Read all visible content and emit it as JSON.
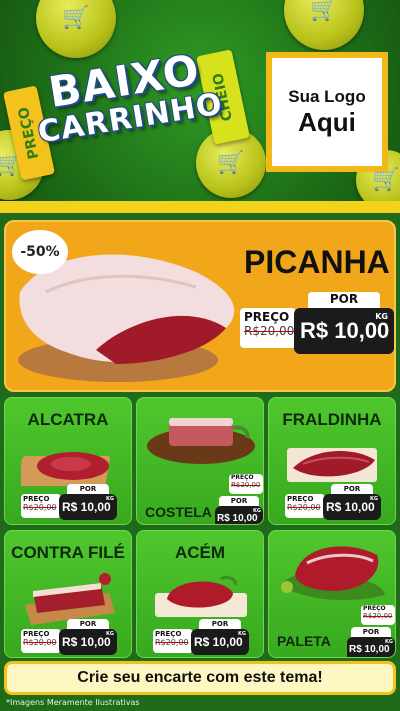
{
  "header": {
    "ribbon_left": "PREÇO",
    "ribbon_right": "CHEIO",
    "title_line1": "BAIXO",
    "title_line2": "CARRINHO",
    "logo_line1": "Sua Logo",
    "logo_line2": "Aqui"
  },
  "hero": {
    "discount": "-50%",
    "name": "PICANHA",
    "price_label": "PREÇO",
    "old_price": "R$20,00",
    "por_label": "POR",
    "new_price": "R$ 10,00",
    "unit": "KG"
  },
  "products": [
    {
      "name": "ALCATRA",
      "price_label": "PREÇO",
      "old_price": "R$20,00",
      "por_label": "POR",
      "new_price": "R$ 10,00",
      "unit": "KG"
    },
    {
      "name": "COSTELA",
      "price_label": "PREÇO",
      "old_price": "R$20,00",
      "por_label": "POR",
      "new_price": "R$ 10,00",
      "unit": "KG"
    },
    {
      "name": "FRALDINHA",
      "price_label": "PREÇO",
      "old_price": "R$20,00",
      "por_label": "POR",
      "new_price": "R$ 10,00",
      "unit": "KG"
    },
    {
      "name": "CONTRA FILÉ",
      "price_label": "PREÇO",
      "old_price": "R$20,00",
      "por_label": "POR",
      "new_price": "R$ 10,00",
      "unit": "KG"
    },
    {
      "name": "ACÉM",
      "price_label": "PREÇO",
      "old_price": "R$20,00",
      "por_label": "POR",
      "new_price": "R$ 10,00",
      "unit": "KG"
    },
    {
      "name": "PALETA",
      "price_label": "PREÇO",
      "old_price": "R$20,00",
      "por_label": "POR",
      "new_price": "R$ 10,00",
      "unit": "KG"
    }
  ],
  "footer": {
    "banner": "Crie seu encarte com este tema!",
    "disclaimer": "*Imagens Meramente Ilustrativas"
  },
  "colors": {
    "header_green": "#1c6a16",
    "card_green": "#4fc72d",
    "hero_orange": "#f2a71a",
    "accent_yellow": "#f2d21a",
    "price_black": "#1b1b1b"
  }
}
